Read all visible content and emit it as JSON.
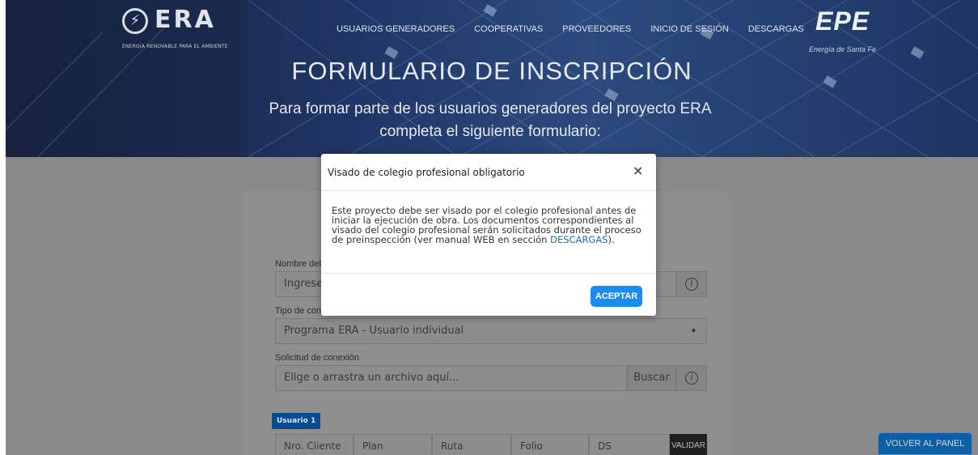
{
  "header": {
    "logo_era_text": "ERA",
    "logo_era_tagline": "ENERGÍA RENOVABLE PARA EL AMBIENTE",
    "nav": [
      "USUARIOS GENERADORES",
      "COOPERATIVAS",
      "PROVEEDORES",
      "INICIO DE SESIÓN",
      "DESCARGAS"
    ],
    "logo_epe_text": "EPE",
    "logo_epe_tagline": "Energía de Santa Fe",
    "title": "FORMULARIO DE INSCRIPCIÓN",
    "subtitle": "Para formar parte de los usuarios generadores del proyecto ERA completa el siguiente formulario:"
  },
  "form": {
    "nombre_label": "Nombre del pr",
    "nombre_placeholder": "Ingrese ac",
    "tipo_label": "Tipo de conexi",
    "tipo_value": "Programa ERA - Usuario individual",
    "solicitud_label": "Solicitud de conexión",
    "solicitud_placeholder": "Elige o arrastra un archivo aquí...",
    "buscar_label": "Buscar",
    "usuario_badge": "Usuario 1",
    "columns": [
      "Nro. Cliente",
      "Plan",
      "Ruta",
      "Folio",
      "DS"
    ],
    "validar_label": "VALIDAR"
  },
  "volver_label": "VOLVER AL PANEL",
  "modal": {
    "title": "Visado de colegio profesional obligatorio",
    "close": "×",
    "body_before": "Este proyecto debe ser visado por el colegio profesional antes de iniciar la ejecución de obra. Los documentos correspondientes al visado del colegio profesional serán solicitados durante el proceso de preinspección (ver manual WEB en sección ",
    "body_link": "DESCARGAS",
    "body_after": ").",
    "accept": "ACEPTAR"
  },
  "colors": {
    "accent": "#1a8cf0",
    "overlay": "#8a8a8a",
    "badge": "#0a4a8f"
  }
}
